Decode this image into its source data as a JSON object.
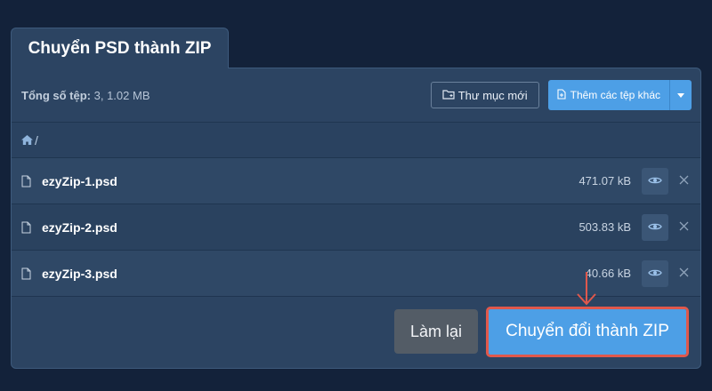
{
  "tab": {
    "title": "Chuyển PSD thành ZIP"
  },
  "toolbar": {
    "total_label": "Tổng số tệp:",
    "total_value": "3, 1.02 MB",
    "new_folder_label": "Thư mục mới",
    "add_files_label": "Thêm các tệp khác"
  },
  "breadcrumb": {
    "path": "/"
  },
  "files": [
    {
      "name": "ezyZip-1.psd",
      "size": "471.07 kB"
    },
    {
      "name": "ezyZip-2.psd",
      "size": "503.83 kB"
    },
    {
      "name": "ezyZip-3.psd",
      "size": "40.66 kB"
    }
  ],
  "footer": {
    "reset_label": "Làm lại",
    "convert_label": "Chuyển đổi thành ZIP"
  },
  "colors": {
    "background": "#13223a",
    "panel": "#2c4462",
    "accent": "#4d9fe6",
    "highlight": "#e0584c"
  }
}
